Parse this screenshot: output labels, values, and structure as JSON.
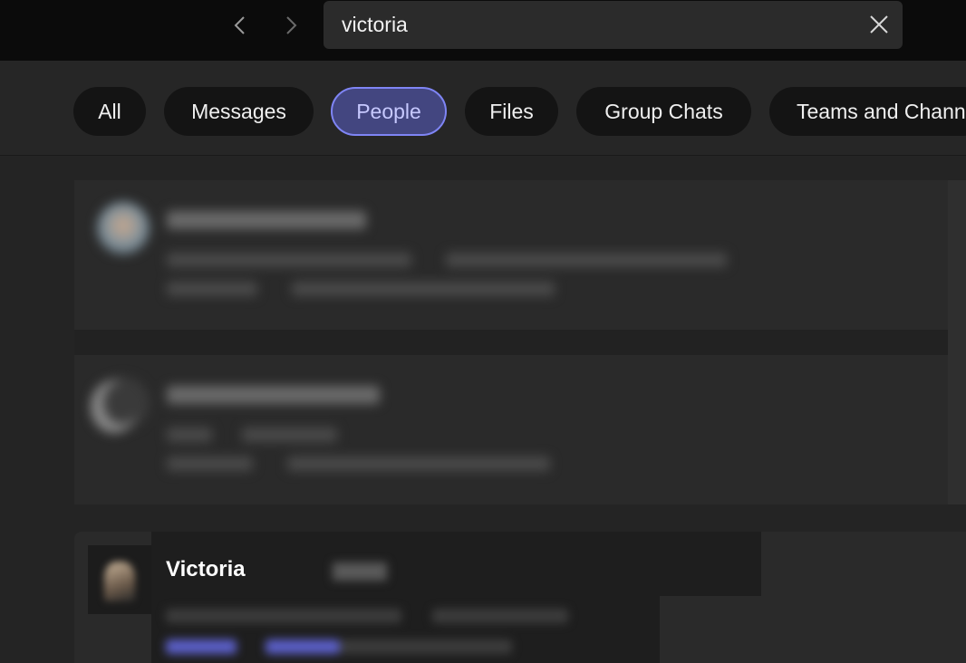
{
  "nav": {
    "back_icon": "chevron-left-icon",
    "forward_icon": "chevron-right-icon"
  },
  "search": {
    "value": "victoria",
    "clear_icon": "close-icon"
  },
  "filters": {
    "items": [
      {
        "label": "All"
      },
      {
        "label": "Messages"
      },
      {
        "label": "People",
        "selected": true
      },
      {
        "label": "Files"
      },
      {
        "label": "Group Chats"
      },
      {
        "label": "Teams and Chann"
      }
    ]
  },
  "results": {
    "highlighted": {
      "name": "Victoria"
    }
  },
  "colors": {
    "accent": "#7f85f5",
    "accent_bg": "#434680",
    "background": "#262626",
    "topbar": "#0b0b0b"
  }
}
